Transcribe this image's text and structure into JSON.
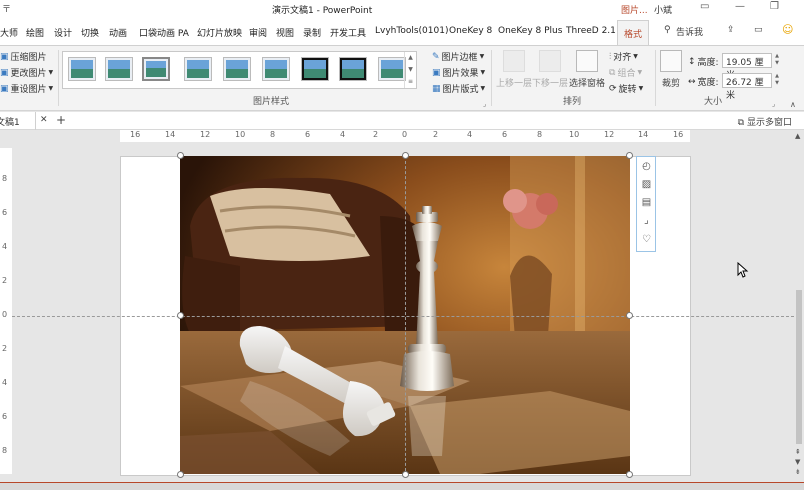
{
  "window": {
    "title": "演示文稿1  -  PowerPoint",
    "context_tab_group": "图片...",
    "user_name": "小斌",
    "qat_glyph": "〒"
  },
  "tabs": [
    {
      "label": "大师"
    },
    {
      "label": "绘图"
    },
    {
      "label": "设计"
    },
    {
      "label": "切换"
    },
    {
      "label": "动画"
    },
    {
      "label": "口袋动画 PA"
    },
    {
      "label": "幻灯片放映"
    },
    {
      "label": "审阅"
    },
    {
      "label": "视图"
    },
    {
      "label": "录制"
    },
    {
      "label": "开发工具"
    },
    {
      "label": "LvyhTools(0101)"
    },
    {
      "label": "OneKey 8"
    },
    {
      "label": "OneKey 8 Plus"
    },
    {
      "label": "ThreeD 2.1"
    },
    {
      "label": "格式"
    }
  ],
  "tell_me": "告诉我",
  "ribbon": {
    "adjust": {
      "compress": "压缩图片",
      "change": "更改图片",
      "reset": "重设图片"
    },
    "picture_styles": {
      "group_label": "图片样式",
      "border": "图片边框",
      "effects": "图片效果",
      "layout": "图片版式",
      "thumb_count": 11
    },
    "arrange": {
      "group_label": "排列",
      "bring_forward": "上移一层",
      "send_backward": "下移一层",
      "selection_pane": "选择窗格",
      "align": "对齐",
      "group": "组合",
      "rotate": "旋转"
    },
    "size": {
      "group_label": "大小",
      "crop": "裁剪",
      "height_label": "高度:",
      "height_value": "19.05 厘米",
      "width_label": "宽度:",
      "width_value": "26.72 厘米"
    }
  },
  "doc_tab": {
    "label": "文稿1",
    "close": "✕",
    "new_tab": "+",
    "multi_window": "显示多窗口"
  },
  "ruler": {
    "h_labels": [
      "16",
      "14",
      "12",
      "10",
      "8",
      "6",
      "4",
      "2",
      "0",
      "2",
      "4",
      "6",
      "8",
      "10",
      "12",
      "14",
      "16"
    ],
    "v_labels": [
      "8",
      "6",
      "4",
      "2",
      "0",
      "2",
      "4",
      "6",
      "8"
    ]
  },
  "colors": {
    "accent": "#b7472a",
    "canvas": "#e6e6e6",
    "ribbon": "#f3f3f3",
    "selection_border": "#9bc4e6"
  },
  "layout_options_icons": [
    "shape-icon",
    "picture-icon",
    "text-wrap-icon",
    "crop-icon",
    "heart-icon"
  ]
}
